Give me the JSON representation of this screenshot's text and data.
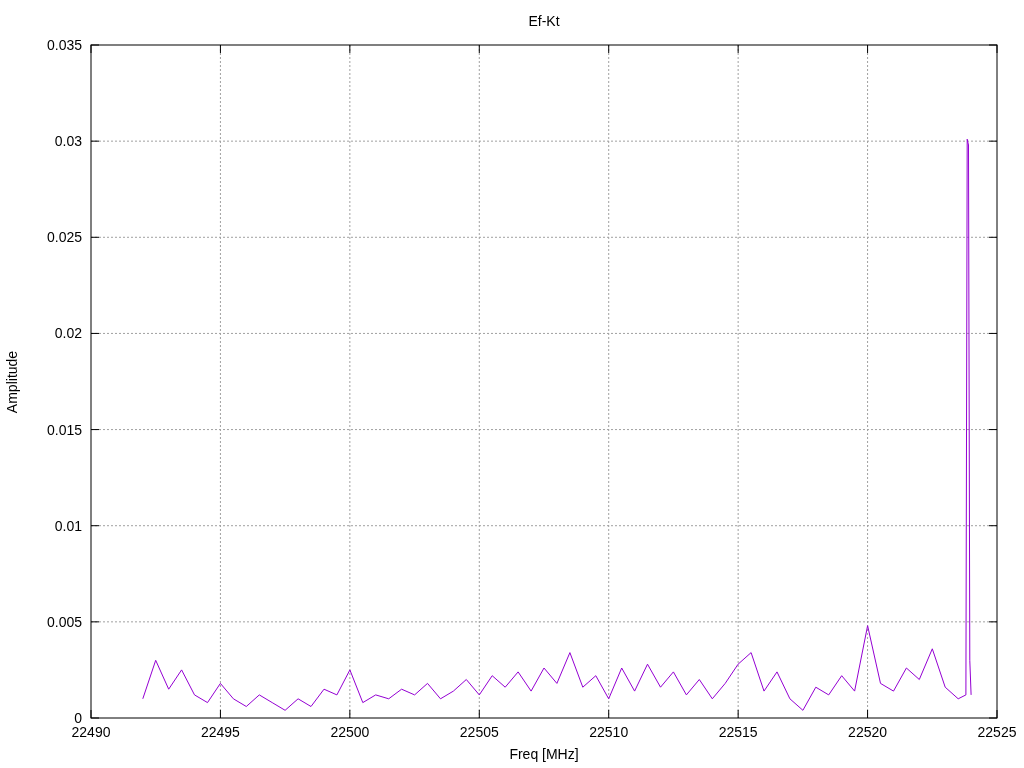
{
  "chart_data": {
    "type": "line",
    "title": "Ef-Kt",
    "xlabel": "Freq [MHz]",
    "ylabel": "Amplitude",
    "grid": true,
    "xlim": [
      22490,
      22525
    ],
    "ylim": [
      0,
      0.035
    ],
    "xticks": [
      22490,
      22495,
      22500,
      22505,
      22510,
      22515,
      22520,
      22525
    ],
    "yticks": [
      {
        "value": 0,
        "label": "0"
      },
      {
        "value": 0.005,
        "label": "0.005"
      },
      {
        "value": 0.01,
        "label": "0.01"
      },
      {
        "value": 0.015,
        "label": "0.015"
      },
      {
        "value": 0.02,
        "label": "0.02"
      },
      {
        "value": 0.025,
        "label": "0.025"
      },
      {
        "value": 0.03,
        "label": "0.03"
      },
      {
        "value": 0.035,
        "label": "0.035"
      }
    ],
    "x": [
      22492,
      22492.5,
      22493,
      22493.5,
      22494,
      22494.5,
      22495,
      22495.5,
      22496,
      22496.5,
      22497,
      22497.5,
      22498,
      22498.5,
      22499,
      22499.5,
      22500,
      22500.5,
      22501,
      22501.5,
      22502,
      22502.5,
      22503,
      22503.5,
      22504,
      22504.5,
      22505,
      22505.5,
      22506,
      22506.5,
      22507,
      22507.5,
      22508,
      22508.5,
      22509,
      22509.5,
      22510,
      22510.5,
      22511,
      22511.5,
      22512,
      22512.5,
      22513,
      22513.5,
      22514,
      22514.5,
      22515,
      22515.5,
      22516,
      22516.5,
      22517,
      22517.5,
      22518,
      22518.5,
      22519,
      22519.5,
      22520,
      22520.5,
      22521,
      22521.5,
      22522,
      22522.5,
      22523,
      22523.5,
      22523.8,
      22523.85,
      22523.9,
      22523.95,
      22524
    ],
    "series": [
      {
        "color": "#9400d3",
        "values": [
          0.001,
          0.003,
          0.0015,
          0.0025,
          0.0012,
          0.0008,
          0.0018,
          0.001,
          0.0006,
          0.0012,
          0.0008,
          0.0004,
          0.001,
          0.0006,
          0.0015,
          0.0012,
          0.0025,
          0.0008,
          0.0012,
          0.001,
          0.0015,
          0.0012,
          0.0018,
          0.001,
          0.0014,
          0.002,
          0.0012,
          0.0022,
          0.0016,
          0.0024,
          0.0014,
          0.0026,
          0.0018,
          0.0034,
          0.0016,
          0.0022,
          0.001,
          0.0026,
          0.0014,
          0.0028,
          0.0016,
          0.0024,
          0.0012,
          0.002,
          0.001,
          0.0018,
          0.0028,
          0.0034,
          0.0014,
          0.0024,
          0.001,
          0.0004,
          0.0016,
          0.0012,
          0.0022,
          0.0014,
          0.0048,
          0.0018,
          0.0014,
          0.0026,
          0.002,
          0.0036,
          0.0016,
          0.001,
          0.0012,
          0.0301,
          0.0298,
          0.003,
          0.0012
        ]
      }
    ]
  }
}
